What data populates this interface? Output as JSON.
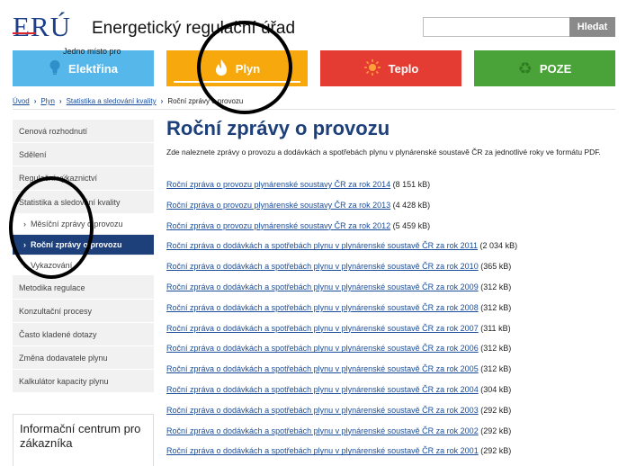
{
  "header": {
    "logo_text": "ERÚ",
    "site_title": "Energetický regulační úřad",
    "search_button": "Hledat",
    "search_value": ""
  },
  "sectors": [
    {
      "label": "Elektřina",
      "icon": "lightbulb-icon",
      "color": "#55b7ea"
    },
    {
      "label": "Plyn",
      "icon": "flame-icon",
      "color": "#f6a80c",
      "active": true
    },
    {
      "label": "Teplo",
      "icon": "sun-icon",
      "color": "#e43c33"
    },
    {
      "label": "POZE",
      "icon": "recycle-icon",
      "color": "#4aa338"
    }
  ],
  "breadcrumb": {
    "items": [
      "Úvod",
      "Plyn",
      "Statistika a sledování kvality"
    ],
    "current": "Roční zprávy o provozu"
  },
  "sidebar": {
    "items": [
      "Cenová rozhodnutí",
      "Sdělení",
      "Regulační výkaznictví",
      "Statistika a sledování kvality"
    ],
    "subitems": [
      "Měsíční zprávy o provozu",
      "Roční zprávy o provozu",
      "Vykazování"
    ],
    "items_after": [
      "Metodika regulace",
      "Konzultační procesy",
      "Často kladené dotazy",
      "Změna dodavatele plynu",
      "Kalkulátor kapacity plynu"
    ],
    "active_subitem": "Roční zprávy o provozu"
  },
  "info_box": {
    "title": "Informační centrum pro zákazníka",
    "line": "Jedno místo pro"
  },
  "main": {
    "title": "Roční zprávy o provozu",
    "intro": "Zde naleznete zprávy o provozu a dodávkách a spotřebách plynu v plynárenské soustavě ČR za jednotlivé roky ve formátu PDF.",
    "reports": [
      {
        "link": "Roční zpráva o provozu plynárenské soustavy ČR za rok 2014",
        "size": "(8 151 kB)"
      },
      {
        "link": "Roční zpráva o provozu plynárenské soustavy ČR za rok 2013",
        "size": "(4 428 kB)"
      },
      {
        "link": "Roční zpráva o provozu plynárenské soustavy ČR za rok 2012",
        "size": "(5 459 kB)"
      },
      {
        "link": "Roční zpráva o dodávkách a spotřebách plynu v plynárenské soustavě ČR za rok 2011",
        "size": "(2 034 kB)"
      },
      {
        "link": "Roční zpráva o dodávkách a spotřebách plynu v plynárenské soustavě ČR za rok 2010",
        "size": "(365 kB)"
      },
      {
        "link": "Roční zpráva o dodávkách a spotřebách plynu v plynárenské soustavě ČR za rok 2009",
        "size": "(312 kB)"
      },
      {
        "link": "Roční zpráva o dodávkách a spotřebách plynu v plynárenské soustavě ČR za rok 2008",
        "size": "(312 kB)"
      },
      {
        "link": "Roční zpráva o dodávkách a spotřebách plynu v plynárenské soustavě ČR za rok 2007",
        "size": "(311 kB)"
      },
      {
        "link": "Roční zpráva o dodávkách a spotřebách plynu v plynárenské soustavě ČR za rok 2006",
        "size": "(312 kB)"
      },
      {
        "link": "Roční zpráva o dodávkách a spotřebách plynu v plynárenské soustavě ČR za rok 2005",
        "size": "(312 kB)"
      },
      {
        "link": "Roční zpráva o dodávkách a spotřebách plynu v plynárenské soustavě ČR za rok 2004",
        "size": "(304 kB)"
      },
      {
        "link": "Roční zpráva o dodávkách a spotřebách plynu v plynárenské soustavě ČR za rok 2003",
        "size": "(292 kB)"
      },
      {
        "link": "Roční zpráva o dodávkách a spotřebách plynu v plynárenské soustavě ČR za rok 2002",
        "size": "(292 kB)"
      },
      {
        "link": "Roční zpráva o dodávkách a spotřebách plynu v plynárenské soustavě ČR za rok 2001",
        "size": "(292 kB)"
      }
    ]
  },
  "colors": {
    "brand_blue": "#1d3f7a",
    "link_blue": "#1a4d9a",
    "brand_red": "#d7282f"
  }
}
